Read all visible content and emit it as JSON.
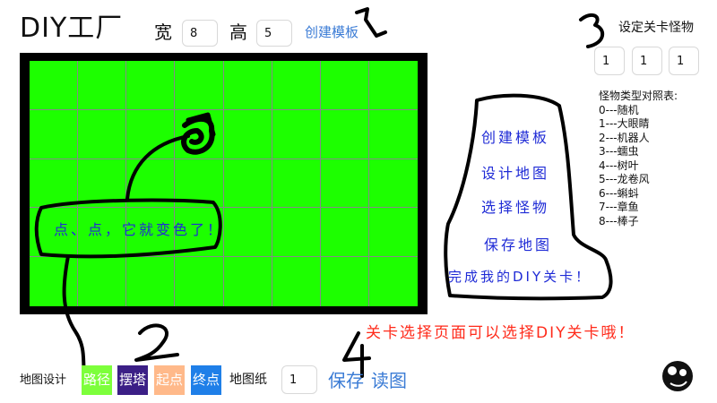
{
  "header": {
    "title": "DIY工厂",
    "width_label": "宽",
    "width_value": "8",
    "height_label": "高",
    "height_value": "5",
    "create_template_link": "创建模板"
  },
  "monster_panel": {
    "title": "设定关卡怪物",
    "slots": [
      "1",
      "1",
      "1"
    ],
    "legend_title": "怪物类型对照表:",
    "legend": [
      "0---随机",
      "1---大眼睛",
      "2---机器人",
      "3---蠕虫",
      "4---树叶",
      "5---龙卷风",
      "6---蝌蚪",
      "7---章鱼",
      "8---棒子"
    ]
  },
  "board": {
    "cols": 8,
    "rows": 5,
    "cell_color": "#1dff00",
    "frame_color": "#000000"
  },
  "annotations": {
    "tap_note": "点、点，它就变色了！",
    "steps": [
      "创建模板",
      "设计地图",
      "选择怪物",
      "保存地图"
    ],
    "goal": "完成我的DIY关卡！",
    "level_select_note": "关卡选择页面可以选择DIY关卡哦！",
    "numbers": [
      "1",
      "2",
      "3",
      "4"
    ]
  },
  "toolbar": {
    "map_design_label": "地图设计",
    "tools": [
      {
        "label": "路径",
        "color": "#7dff3b"
      },
      {
        "label": "摆塔",
        "color": "#3b1f86"
      },
      {
        "label": "起点",
        "color": "#ffb98a"
      },
      {
        "label": "终点",
        "color": "#1f7fe8"
      }
    ],
    "map_sheet_label": "地图纸",
    "map_sheet_value": "1",
    "save_label": "保存",
    "load_label": "读图"
  },
  "colors": {
    "link": "#3a7bd5",
    "handwriting": "#1f2bd6",
    "note_red": "#ff2a1a"
  }
}
